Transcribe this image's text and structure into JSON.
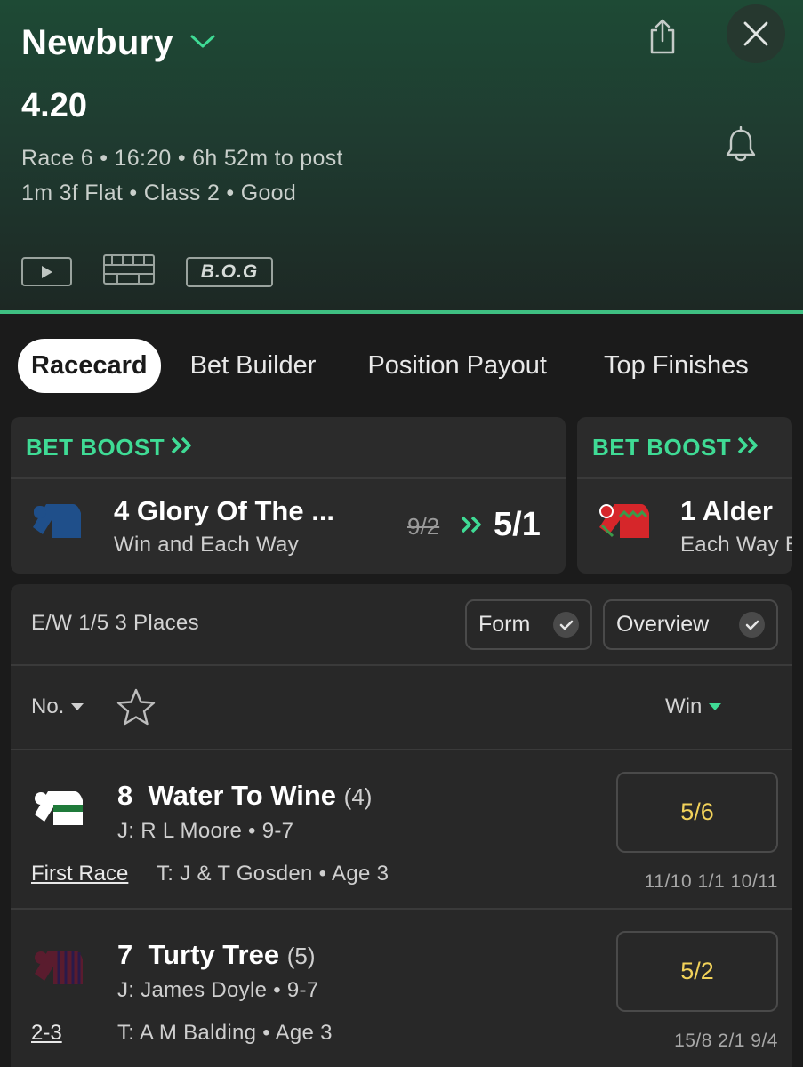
{
  "header": {
    "venue": "Newbury",
    "race_time": "4.20",
    "meta_line1": "Race 6 • 16:20 • 6h 52m to post",
    "meta_line2": "1m 3f Flat  • Class 2  • Good",
    "bog_label": "B.O.G"
  },
  "tabs": [
    "Racecard",
    "Bet Builder",
    "Position Payout",
    "Top Finishes"
  ],
  "boosts": [
    {
      "title": "BET BOOST",
      "runner": "4  Glory Of The ...",
      "market": "Win and Each Way",
      "old_odds": "9/2",
      "new_odds": "5/1",
      "silk_color": "#1f4f8a"
    },
    {
      "title": "BET BOOST",
      "runner": "1  Alder",
      "market": "Each Way B",
      "silk_color": "#d6262a"
    }
  ],
  "racecard": {
    "each_way": "E/W 1/5 3 Places",
    "toggles": {
      "form": "Form",
      "overview": "Overview"
    },
    "sort_number": "No.",
    "sort_win": "Win",
    "runners": [
      {
        "number": "8",
        "name": "Water To Wine",
        "draw": "(4)",
        "jockey_line": "J: R L Moore • 9-7",
        "form": "First Race",
        "trainer_line": "T: J & T Gosden • Age 3",
        "odds": "5/6",
        "previous_odds": "11/10  1/1  10/11"
      },
      {
        "number": "7",
        "name": "Turty Tree",
        "draw": "(5)",
        "jockey_line": "J: James Doyle • 9-7",
        "form": "2-3",
        "trainer_line": "T: A M Balding  • Age 3",
        "odds": "5/2",
        "previous_odds": "15/8  2/1  9/4"
      }
    ]
  },
  "colors": {
    "accent_green": "#3fdb95",
    "odds_yellow": "#f2d25a"
  }
}
